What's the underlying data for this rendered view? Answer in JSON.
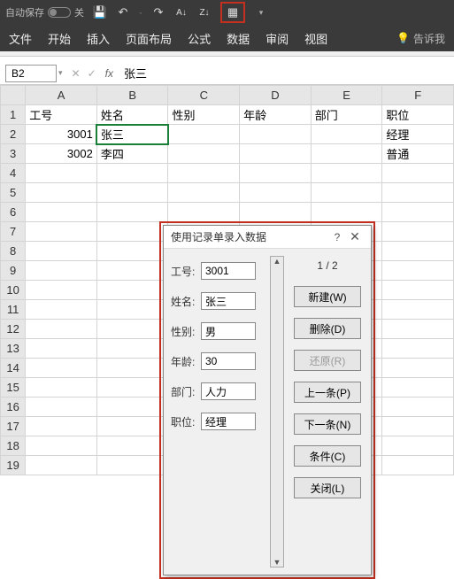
{
  "titlebar": {
    "autosave_label": "自动保存",
    "autosave_state": "关"
  },
  "ribbon": {
    "tabs": [
      "文件",
      "开始",
      "插入",
      "页面布局",
      "公式",
      "数据",
      "审阅",
      "视图"
    ],
    "tell_me": "告诉我"
  },
  "name_box": "B2",
  "formula_value": "张三",
  "columns": [
    "A",
    "B",
    "C",
    "D",
    "E",
    "F"
  ],
  "headers": {
    "A": "工号",
    "B": "姓名",
    "C": "性别",
    "D": "年龄",
    "E": "部门",
    "F": "职位"
  },
  "rows": [
    {
      "n": 1,
      "A": "工号",
      "B": "姓名",
      "C": "性别",
      "D": "年龄",
      "E": "部门",
      "F": "职位"
    },
    {
      "n": 2,
      "A": "3001",
      "B": "张三",
      "C": "",
      "D": "",
      "E": "",
      "F": "经理"
    },
    {
      "n": 3,
      "A": "3002",
      "B": "李四",
      "C": "",
      "D": "",
      "E": "",
      "F": "普通"
    },
    {
      "n": 4
    },
    {
      "n": 5
    },
    {
      "n": 6
    },
    {
      "n": 7
    },
    {
      "n": 8
    },
    {
      "n": 9
    },
    {
      "n": 10
    },
    {
      "n": 11
    },
    {
      "n": 12
    },
    {
      "n": 13
    },
    {
      "n": 14
    },
    {
      "n": 15
    },
    {
      "n": 16
    },
    {
      "n": 17
    },
    {
      "n": 18
    },
    {
      "n": 19
    }
  ],
  "dialog": {
    "title": "使用记录单录入数据",
    "help": "?",
    "close": "✕",
    "counter": "1 / 2",
    "fields": {
      "f1_label": "工号:",
      "f1_value": "3001",
      "f2_label": "姓名:",
      "f2_value": "张三",
      "f3_label": "性别:",
      "f3_value": "男",
      "f4_label": "年龄:",
      "f4_value": "30",
      "f5_label": "部门:",
      "f5_value": "人力",
      "f6_label": "职位:",
      "f6_value": "经理"
    },
    "buttons": {
      "new": "新建(W)",
      "delete": "删除(D)",
      "restore": "还原(R)",
      "prev": "上一条(P)",
      "next": "下一条(N)",
      "criteria": "条件(C)",
      "close": "关闭(L)"
    }
  }
}
